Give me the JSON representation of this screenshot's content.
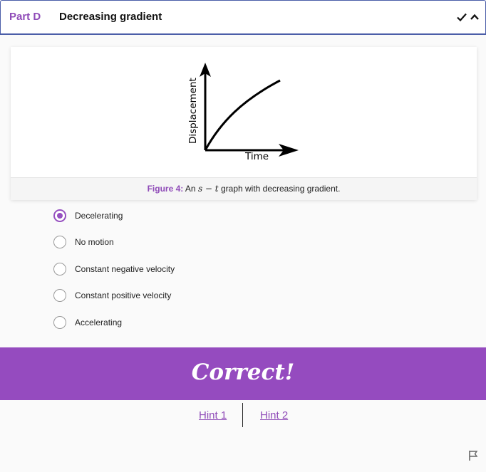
{
  "header": {
    "part_label": "Part D",
    "title": "Decreasing gradient"
  },
  "figure": {
    "y_axis_label": "Displacement",
    "x_axis_label": "Time",
    "caption_label": "Figure 4:",
    "caption_pre": "An",
    "caption_math": "s − t",
    "caption_post": "graph with decreasing gradient."
  },
  "options": [
    {
      "label": "Decelerating",
      "selected": true
    },
    {
      "label": "No motion",
      "selected": false
    },
    {
      "label": "Constant negative velocity",
      "selected": false
    },
    {
      "label": "Constant positive velocity",
      "selected": false
    },
    {
      "label": "Accelerating",
      "selected": false
    }
  ],
  "feedback": {
    "text": "Correct!"
  },
  "hints": {
    "hint1": "Hint 1",
    "hint2": "Hint 2"
  },
  "colors": {
    "accent": "#954bbf",
    "header_border": "#4b5ea8"
  },
  "icons": {
    "check": "check-icon",
    "collapse": "chevron-up-icon",
    "report": "flag-icon"
  }
}
